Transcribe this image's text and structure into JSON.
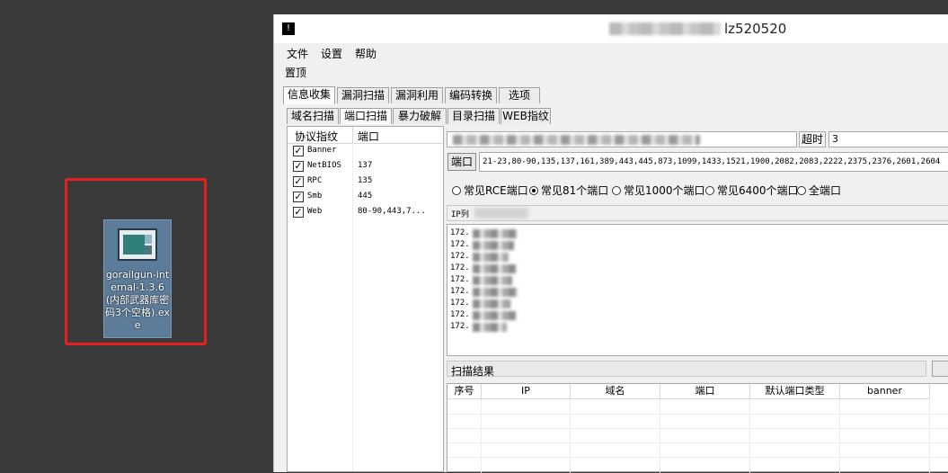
{
  "desktop": {
    "icon_label": "gorailgun-internal-1.3.6(内部武器库密码3个空格).exe",
    "icon_name": "app-window-icon",
    "highlight_color": "#e5201f"
  },
  "window": {
    "app_icon_text": "!",
    "title": "lz520520",
    "menu": [
      "文件",
      "设置",
      "帮助"
    ],
    "toolbar_item": "置顶",
    "main_tabs": [
      "信息收集",
      "漏洞扫描",
      "漏洞利用",
      "编码转换",
      "选项"
    ],
    "sub_tabs": [
      "域名扫描",
      "端口扫描",
      "暴力破解",
      "目录扫描",
      "WEB指纹"
    ]
  },
  "protocol_list": {
    "headers": [
      "协议指纹",
      "端口"
    ],
    "rows": [
      {
        "checked": true,
        "name": "Banner",
        "port": ""
      },
      {
        "checked": true,
        "name": "NetBIOS",
        "port": "137"
      },
      {
        "checked": true,
        "name": "RPC",
        "port": "135"
      },
      {
        "checked": true,
        "name": "Smb",
        "port": "445"
      },
      {
        "checked": true,
        "name": "Web",
        "port": "80-90,443,7..."
      }
    ]
  },
  "scan": {
    "timeout_label": "超时",
    "timeout_value": "3",
    "port_button": "端口",
    "port_value": "21-23,80-90,135,137,161,389,443,445,873,1099,1433,1521,1900,2082,2083,2222,2375,2376,2601,2604",
    "port_presets": [
      {
        "label": "常见RCE端口",
        "selected": false
      },
      {
        "label": "常见81个端口",
        "selected": true
      },
      {
        "label": "常见1000个端口",
        "selected": false
      },
      {
        "label": "常见6400个端口",
        "selected": false
      },
      {
        "label": "全端口",
        "selected": false
      }
    ],
    "ip_list_label": "IP列",
    "ip_prefixes": [
      "172.",
      "172.",
      "172.",
      "172.",
      "172.",
      "172.",
      "172.",
      "172.",
      "172."
    ]
  },
  "results": {
    "title": "扫描结果",
    "columns": [
      "序号",
      "IP",
      "域名",
      "端口",
      "默认端口类型",
      "banner"
    ]
  }
}
